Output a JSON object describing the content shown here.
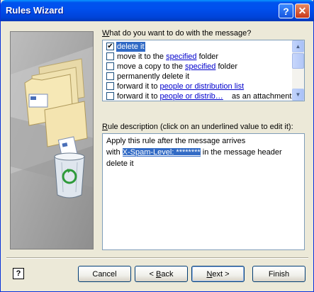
{
  "window": {
    "title": "Rules Wizard"
  },
  "titlebar_buttons": {
    "help": "?",
    "close": "✕"
  },
  "question": {
    "prefix": "W",
    "rest": "hat do you want to do with the message?"
  },
  "actions": [
    {
      "checked": true,
      "before": "delete it",
      "link": "",
      "after": "",
      "selected": true
    },
    {
      "checked": false,
      "before": "move it to the ",
      "link": "specified",
      "after": " folder",
      "selected": false
    },
    {
      "checked": false,
      "before": "move a copy to the ",
      "link": "specified",
      "after": " folder",
      "selected": false
    },
    {
      "checked": false,
      "before": "permanently delete it",
      "link": "",
      "after": "",
      "selected": false
    },
    {
      "checked": false,
      "before": "forward it to ",
      "link": "people or distribution list",
      "after": "",
      "selected": false
    },
    {
      "checked": false,
      "before": "forward it to ",
      "link": "people or distrib…",
      "after": "    as an attachment",
      "selected": false
    }
  ],
  "scroll": {
    "up": "▲",
    "down": "▼"
  },
  "rule_description": {
    "prefix": "R",
    "rest": "ule description (click on an underlined value to edit it):"
  },
  "description_lines": {
    "line1": "Apply this rule after the message arrives",
    "line2_pre": "with ",
    "line2_value": "X-Spam-Level: ********",
    "line2_post": " in the message header",
    "line3": "delete it"
  },
  "buttons": {
    "help_icon": "?",
    "cancel": "Cancel",
    "back_underline": "B",
    "back_pre": "< ",
    "back_post": "ack",
    "next_underline": "N",
    "next_post": "ext >",
    "finish": "Finish"
  }
}
